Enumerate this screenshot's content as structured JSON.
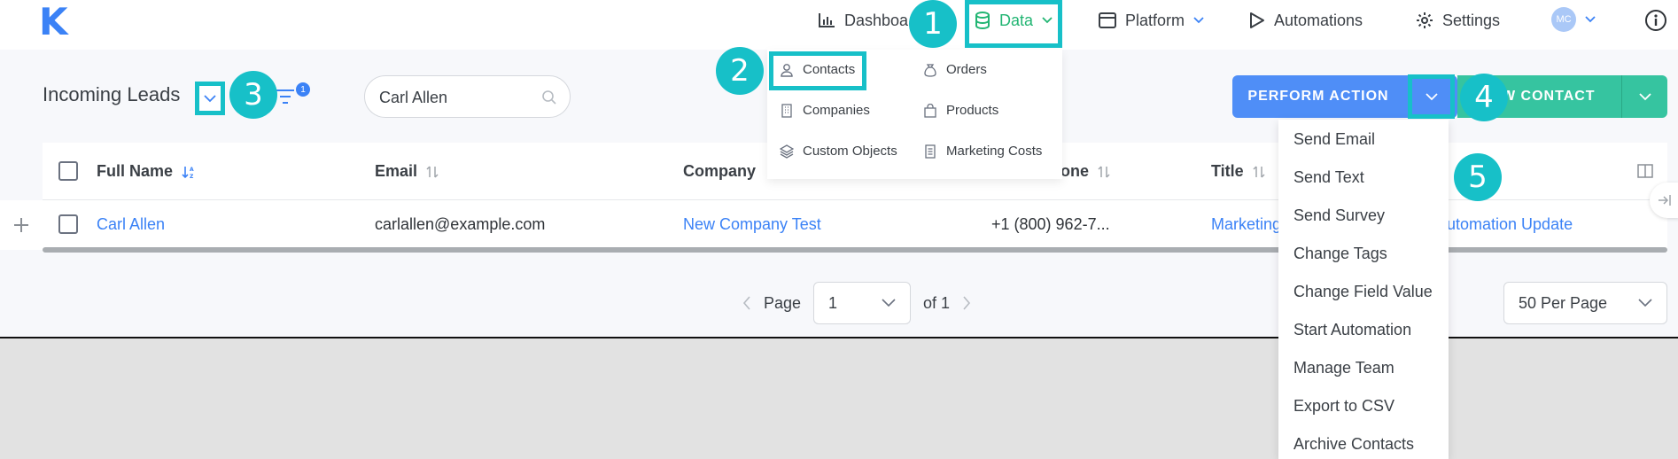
{
  "app": {
    "logo": "K"
  },
  "nav": {
    "dashboard": "Dashboa",
    "data": "Data",
    "platform": "Platform",
    "automations": "Automations",
    "settings": "Settings",
    "avatar_initials": "MC"
  },
  "toolbar": {
    "title": "Incoming Leads",
    "filter_count": "1",
    "search_value": "Carl Allen",
    "perform_action": "PERFORM ACTION",
    "new_contact": "W CONTACT"
  },
  "data_menu": {
    "contacts": "Contacts",
    "orders": "Orders",
    "companies": "Companies",
    "products": "Products",
    "custom_objects": "Custom Objects",
    "marketing_costs": "Marketing Costs"
  },
  "table": {
    "headers": {
      "full_name": "Full Name",
      "email": "Email",
      "company": "Company",
      "phone": "hone",
      "title": "Title"
    },
    "row": {
      "full_name": "Carl Allen",
      "email": "carlallen@example.com",
      "company": "New Company Test",
      "phone": "+1 (800) 962-7...",
      "title": "Marketing",
      "automation": "utomation Update"
    }
  },
  "pagination": {
    "page_label": "Page",
    "page_value": "1",
    "of_label": "of 1",
    "per_page": "50 Per Page"
  },
  "action_menu": [
    "Send Email",
    "Send Text",
    "Send Survey",
    "Change Tags",
    "Change Field Value",
    "Start Automation",
    "Manage Team",
    "Export to CSV",
    "Archive Contacts"
  ],
  "callouts": [
    "1",
    "2",
    "3",
    "4",
    "5"
  ],
  "colors": {
    "accent_blue": "#3b82f6",
    "highlight_teal": "#17c0c8",
    "green": "#36c4a0",
    "data_green": "#22b573"
  }
}
